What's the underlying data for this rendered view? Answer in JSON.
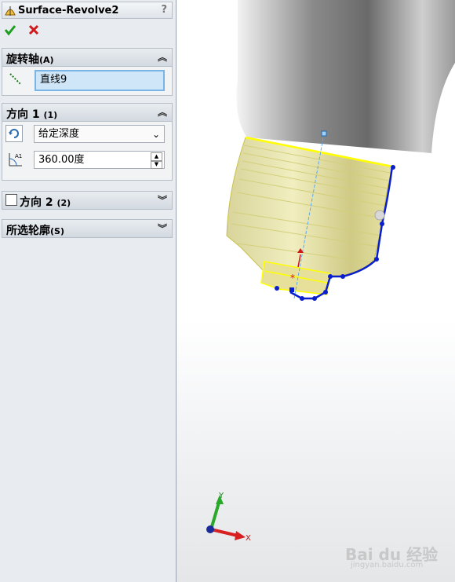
{
  "panel": {
    "title": "Surface-Revolve2",
    "help": "?",
    "ok_icon": "check-icon",
    "cancel_icon": "close-icon",
    "axis_section": {
      "label": "旋转轴",
      "key": "(A)",
      "field_value": "直线9"
    },
    "dir1_section": {
      "label": "方向 1",
      "key": "(1)",
      "type_value": "给定深度",
      "angle_value": "360.00度"
    },
    "dir2_section": {
      "label": "方向 2",
      "key": "(2)",
      "checked": false
    },
    "contours_section": {
      "label": "所选轮廓",
      "key": "(S)"
    }
  },
  "viewport": {
    "triad": {
      "x": "X",
      "y": "Y"
    },
    "watermark": {
      "logo": "Bai du 经验",
      "url": "jingyan.baidu.com"
    }
  },
  "colors": {
    "panel_bg": "#e8ecf1",
    "selection": "#cfe6f8",
    "model_yellow": "#e6e3a0",
    "sketch_blue": "#0a1ecc"
  }
}
